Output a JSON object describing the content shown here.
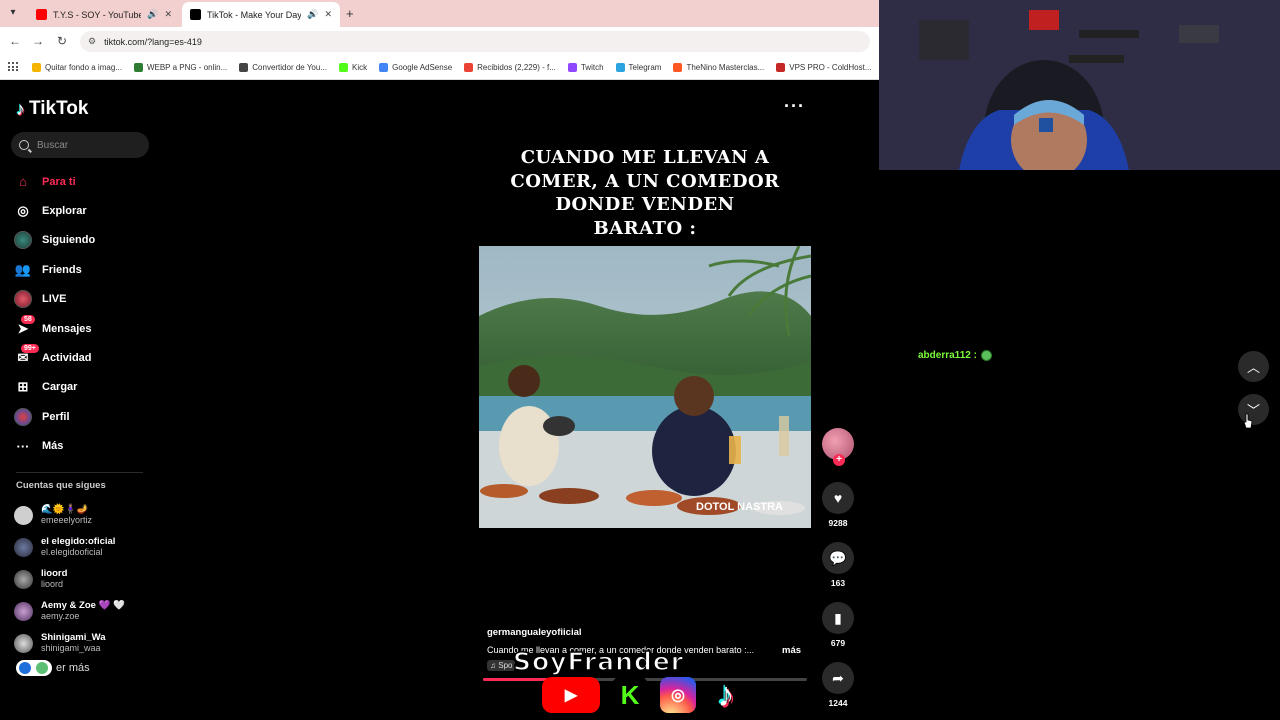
{
  "browser": {
    "tabs": [
      {
        "title": "T.Y.S - SOY - YouTube",
        "icon": "youtube-icon",
        "color": "#ff0000",
        "audio": true
      },
      {
        "title": "TikTok - Make Your Day",
        "icon": "tiktok-icon",
        "color": "#000000",
        "audio": true
      }
    ],
    "url": "tiktok.com/?lang=es-419",
    "bookmarks": [
      {
        "label": "Quitar fondo a imag...",
        "color": "#f4b400"
      },
      {
        "label": "WEBP a PNG - onlin...",
        "color": "#2e7d32"
      },
      {
        "label": "Convertidor de You...",
        "color": "#444444"
      },
      {
        "label": "Kick",
        "color": "#53fc18"
      },
      {
        "label": "Google AdSense",
        "color": "#4285f4"
      },
      {
        "label": "Recibidos (2,229) - f...",
        "color": "#ea4335"
      },
      {
        "label": "Twitch",
        "color": "#9146ff"
      },
      {
        "label": "Telegram",
        "color": "#2aa3df"
      },
      {
        "label": "TheNino Masterclas...",
        "color": "#ff5722"
      },
      {
        "label": "VPS PRO - ColdHost...",
        "color": "#c62828"
      }
    ]
  },
  "tiktok": {
    "logo": "TikTok",
    "search_placeholder": "Buscar",
    "nav": [
      {
        "label": "Para ti",
        "icon": "home-icon",
        "active": true
      },
      {
        "label": "Explorar",
        "icon": "compass-icon"
      },
      {
        "label": "Siguiendo",
        "icon": "following-avatar"
      },
      {
        "label": "Friends",
        "icon": "friends-icon"
      },
      {
        "label": "LIVE",
        "icon": "live-avatar"
      },
      {
        "label": "Mensajes",
        "icon": "messages-icon",
        "badge": "58"
      },
      {
        "label": "Actividad",
        "icon": "activity-icon",
        "badge": "99+"
      },
      {
        "label": "Cargar",
        "icon": "upload-icon"
      },
      {
        "label": "Perfil",
        "icon": "profile-avatar"
      },
      {
        "label": "Más",
        "icon": "more-icon"
      }
    ],
    "following_title": "Cuentas que sigues",
    "following": [
      {
        "name": "🌊🌞🧍🏽‍♀️🪔",
        "user": "emeeelyortiz"
      },
      {
        "name": "el elegido:oficial",
        "user": "el.elegidooficial"
      },
      {
        "name": "lioord",
        "user": "lioord"
      },
      {
        "name": "Aemy & Zoe 💜 🤍",
        "user": "aemy.zoe"
      },
      {
        "name": "Shinigami_Wa",
        "user": "shinigami_waa"
      }
    ],
    "see_more": "er más",
    "video": {
      "caption_lines": [
        "CUANDO ME LLEVAN A",
        "COMER, A UN COMEDOR",
        "DONDE VENDEN",
        "BARATO :"
      ],
      "watermark": "DOTOL NASTRA",
      "author": "germangualeyofiicial",
      "description": "Cuando me llevan a comer, a un comedor donde venden barato :...",
      "more": "más",
      "sound": "Spo",
      "progress": 0.2,
      "likes": "9288",
      "comments": "163",
      "saves": "679",
      "shares": "1244"
    }
  },
  "overlay": {
    "brand": "SoyFrander",
    "socials": [
      "youtube",
      "kick",
      "instagram",
      "tiktok"
    ]
  },
  "chat": {
    "username": "abderra112 :"
  }
}
